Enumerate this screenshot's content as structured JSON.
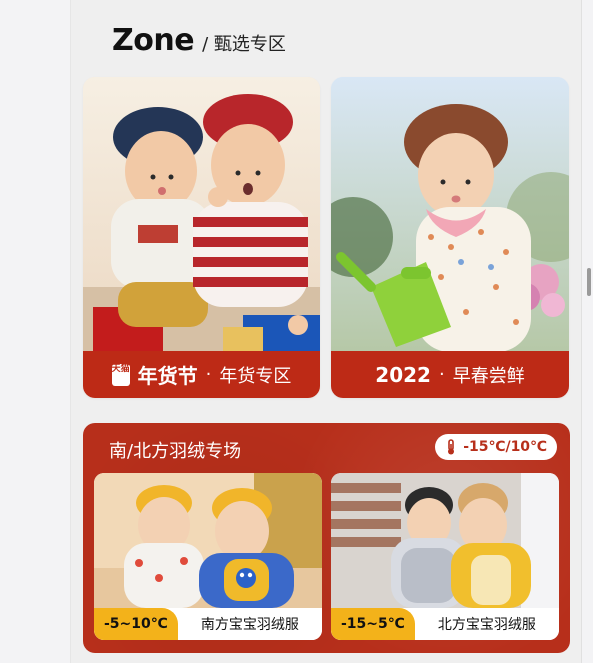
{
  "header": {
    "zone_title": "Zone",
    "zone_subtitle": "/ 甄选专区"
  },
  "cards": [
    {
      "caption_badge": "天猫",
      "caption_title": "年货节",
      "caption_sep": "·",
      "caption_sub": "年货专区"
    },
    {
      "caption_title": "2022",
      "caption_sep": "·",
      "caption_sub": "早春尝鲜"
    }
  ],
  "down_section": {
    "title": "南/北方羽绒专场",
    "temperature_range": "-15℃/10℃",
    "items": [
      {
        "temp": "-5~10℃",
        "label": "南方宝宝羽绒服"
      },
      {
        "temp": "-15~5℃",
        "label": "北方宝宝羽绒服"
      }
    ]
  },
  "colors": {
    "accent_red": "#bd2a16",
    "accent_yellow": "#f3b21a"
  },
  "icons": {
    "thermometer": "thermometer-icon"
  }
}
